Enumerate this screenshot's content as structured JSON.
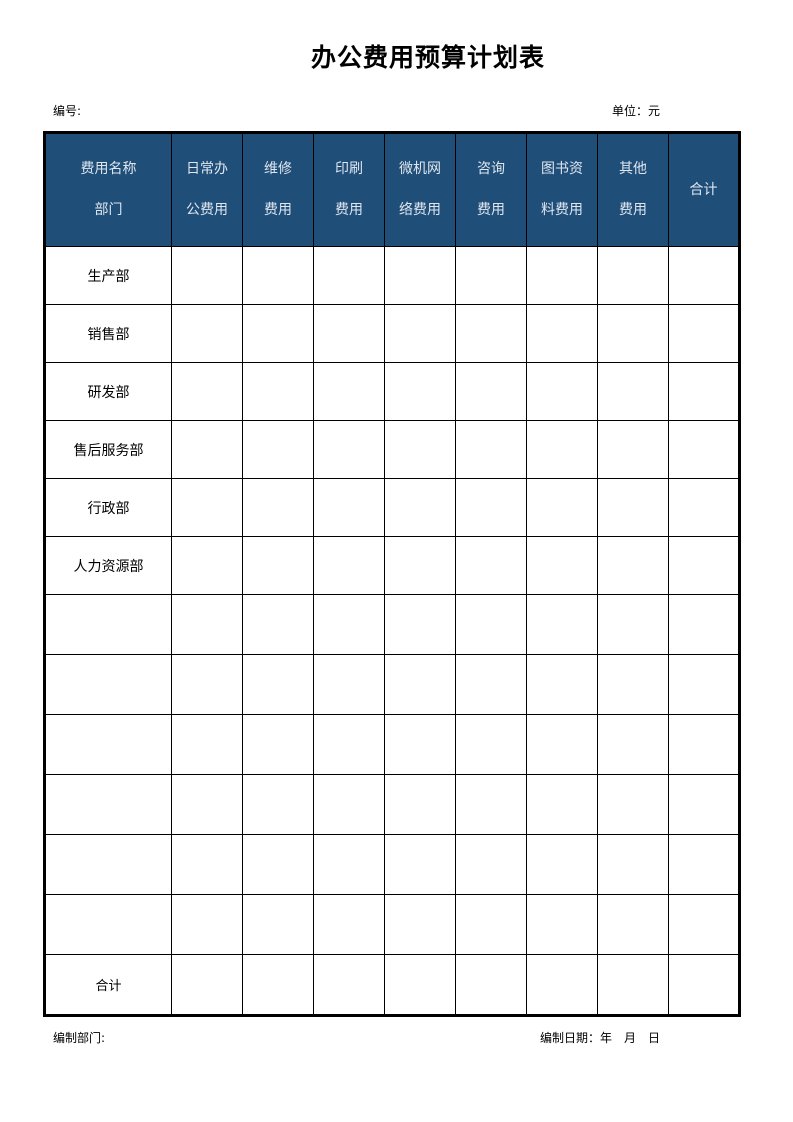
{
  "document": {
    "title": "办公费用预算计划表",
    "code_label": "编号:",
    "unit_label": "单位：元",
    "footer_dept_label": "编制部门:",
    "footer_date_label": "编制日期：年　月　日"
  },
  "table": {
    "header_color": "#1f4e79",
    "headers": [
      {
        "line1": "费用名称",
        "line2": "部门"
      },
      {
        "line1": "日常办",
        "line2": "公费用"
      },
      {
        "line1": "维修",
        "line2": "费用"
      },
      {
        "line1": "印刷",
        "line2": "费用"
      },
      {
        "line1": "微机网",
        "line2": "络费用"
      },
      {
        "line1": "咨询",
        "line2": "费用"
      },
      {
        "line1": "图书资",
        "line2": "料费用"
      },
      {
        "line1": "其他",
        "line2": "费用"
      },
      {
        "line1": "合计",
        "line2": ""
      }
    ],
    "rows": [
      "生产部",
      "销售部",
      "研发部",
      "售后服务部",
      "行政部",
      "人力资源部",
      "",
      "",
      "",
      "",
      "",
      ""
    ],
    "total_label": "合计"
  }
}
